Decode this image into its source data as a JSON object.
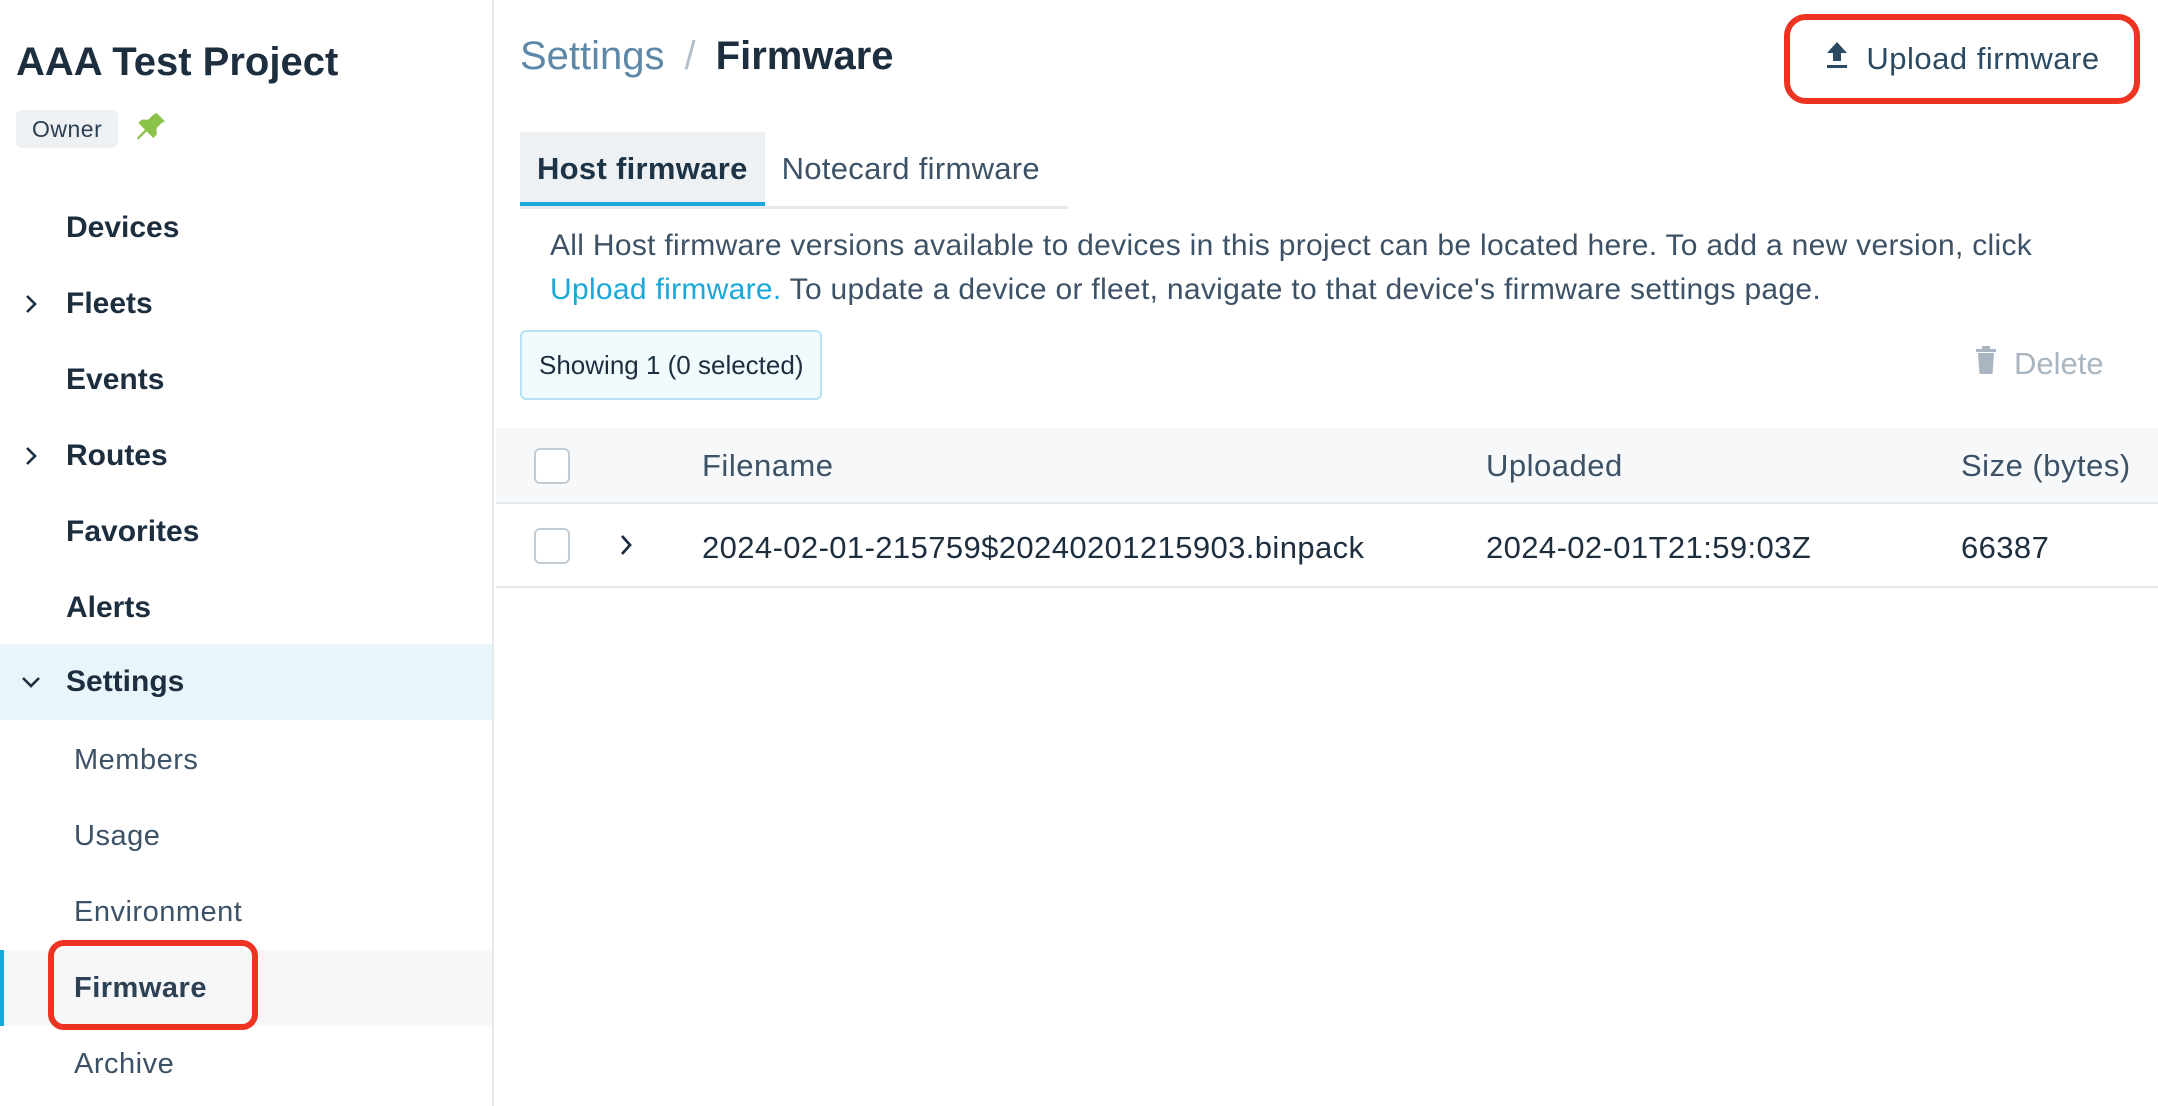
{
  "sidebar": {
    "project_title": "AAA Test Project",
    "role_badge": "Owner",
    "pin_color": "#8bc34a",
    "nav": [
      {
        "label": "Devices",
        "icon": "",
        "expandable": false
      },
      {
        "label": "Fleets",
        "icon": "chevron-right-icon",
        "expandable": true
      },
      {
        "label": "Events",
        "icon": "",
        "expandable": false
      },
      {
        "label": "Routes",
        "icon": "chevron-right-icon",
        "expandable": true
      },
      {
        "label": "Favorites",
        "icon": "",
        "expandable": false
      },
      {
        "label": "Alerts",
        "icon": "",
        "expandable": false
      },
      {
        "label": "Settings",
        "icon": "chevron-down-icon",
        "expandable": true,
        "expanded": true
      }
    ],
    "settings_items": [
      {
        "label": "Members"
      },
      {
        "label": "Usage"
      },
      {
        "label": "Environment"
      },
      {
        "label": "Firmware",
        "current": true
      },
      {
        "label": "Archive"
      }
    ]
  },
  "header": {
    "breadcrumb_parent": "Settings",
    "breadcrumb_separator": "/",
    "breadcrumb_current": "Firmware",
    "upload_button": "Upload firmware",
    "upload_icon": "upload-icon"
  },
  "tabs": [
    {
      "label": "Host firmware",
      "active": true
    },
    {
      "label": "Notecard firmware",
      "active": false
    }
  ],
  "description": {
    "before_link": "All Host firmware versions available to devices in this project can be located here. To add a new version, click ",
    "link": "Upload firmware.",
    "after_link": " To update a device or fleet, navigate to that device's firmware settings page."
  },
  "toolbar": {
    "showing": "Showing 1 (0 selected)",
    "delete_label": "Delete",
    "delete_icon": "trash-icon"
  },
  "table": {
    "columns": [
      "Filename",
      "Uploaded",
      "Size (bytes)"
    ],
    "rows": [
      {
        "filename": "2024-02-01-215759$20240201215903.binpack",
        "uploaded": "2024-02-01T21:59:03Z",
        "size": "66387"
      }
    ]
  },
  "colors": {
    "accent": "#1aa7d9",
    "highlight": "#ee3322",
    "text_primary": "#1d2e3f"
  }
}
